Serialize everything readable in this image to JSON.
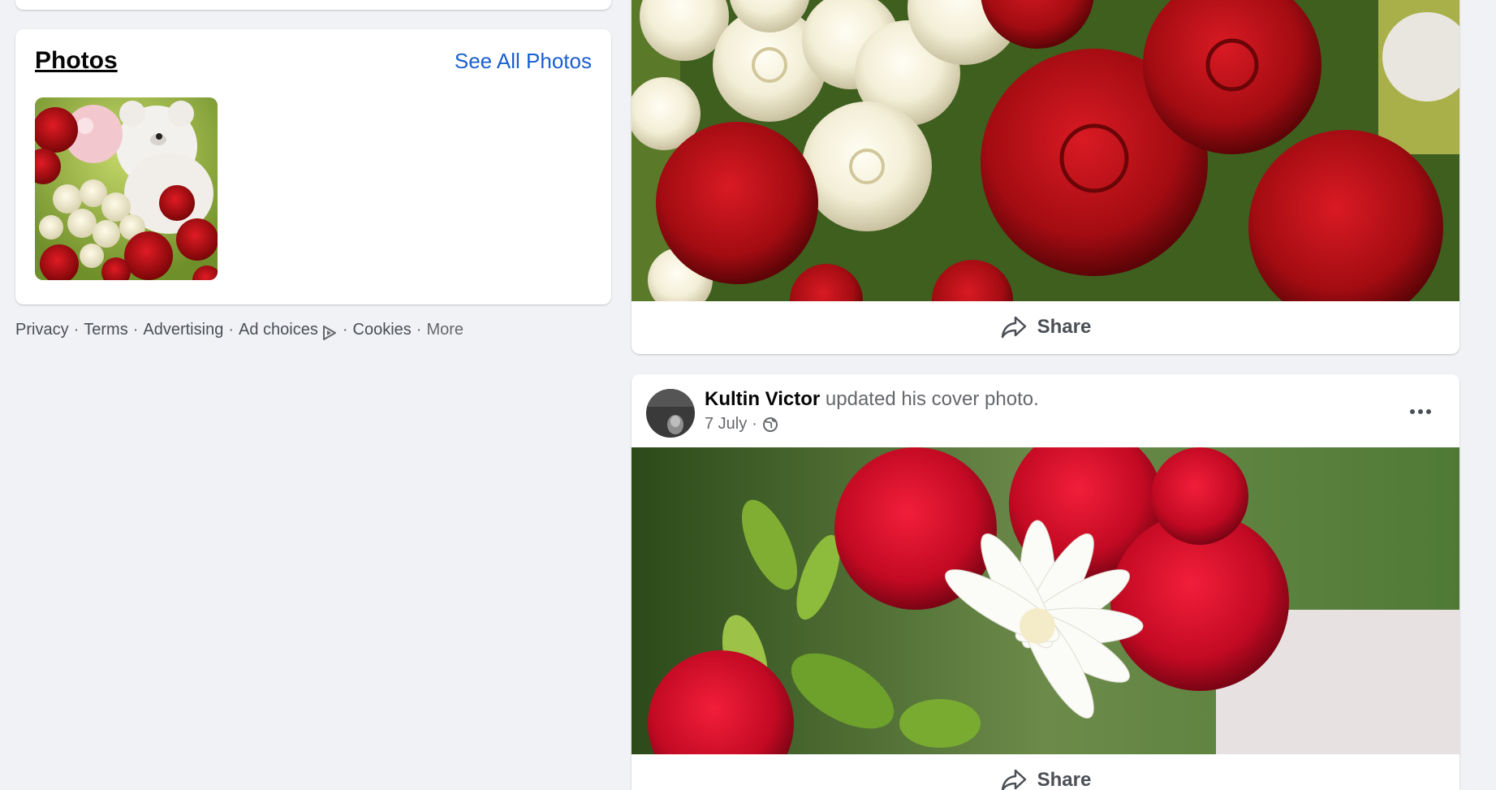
{
  "photos_card": {
    "title": "Photos",
    "see_all_label": "See All Photos"
  },
  "footer": {
    "privacy": "Privacy",
    "terms": "Terms",
    "advertising": "Advertising",
    "ad_choices": "Ad choices",
    "cookies": "Cookies",
    "more": "More",
    "separator": "·"
  },
  "post_top": {
    "share_label": "Share"
  },
  "post_2": {
    "author": "Kultin Victor",
    "action": "updated his cover photo.",
    "date": "7 July",
    "meta_separator": "·",
    "share_label": "Share"
  },
  "icons": {
    "share": "share-icon",
    "globe": "globe-icon",
    "more": "more-options-icon",
    "ad_choices": "ad-choices-icon"
  },
  "colors": {
    "background": "#f0f2f5",
    "link_blue": "#1b5fd0",
    "secondary_text": "#65676b"
  }
}
